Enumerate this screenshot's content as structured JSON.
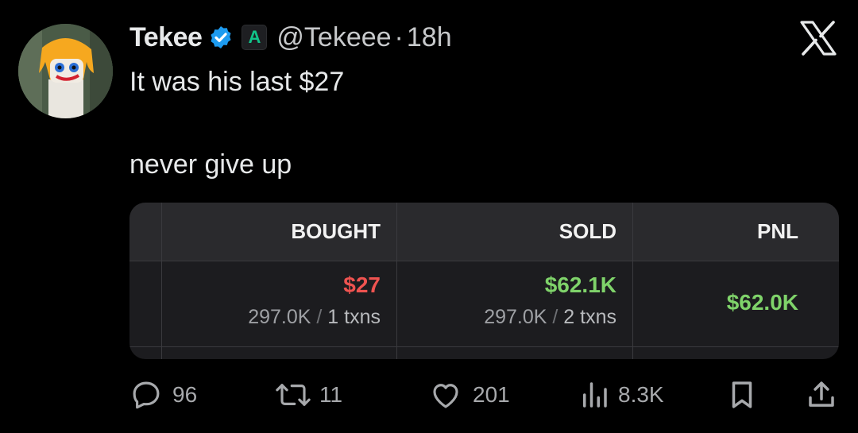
{
  "author": {
    "name": "Tekee",
    "affiliate_badge": "A",
    "handle": "@Tekeee",
    "separator": "·",
    "time": "18h"
  },
  "tweet": {
    "line1": "It was his last $27",
    "line2": "never give up"
  },
  "trade_card": {
    "columns": [
      "BOUGHT",
      "SOLD",
      "PNL"
    ],
    "bought": {
      "amount": "$27",
      "tokens": "297.0K",
      "slash": "/",
      "txns": "1 txns"
    },
    "sold": {
      "amount": "$62.1K",
      "tokens": "297.0K",
      "slash": "/",
      "txns": "2 txns"
    },
    "pnl": "$62.0K",
    "colors": {
      "loss": "#ef5350",
      "gain": "#7fd36a"
    }
  },
  "actions": {
    "replies": "96",
    "reposts": "11",
    "likes": "201",
    "views": "8.3K"
  },
  "icons": [
    "verified-badge-icon",
    "x-logo-icon",
    "reply-icon",
    "repost-icon",
    "like-icon",
    "views-icon",
    "bookmark-icon",
    "share-icon"
  ]
}
